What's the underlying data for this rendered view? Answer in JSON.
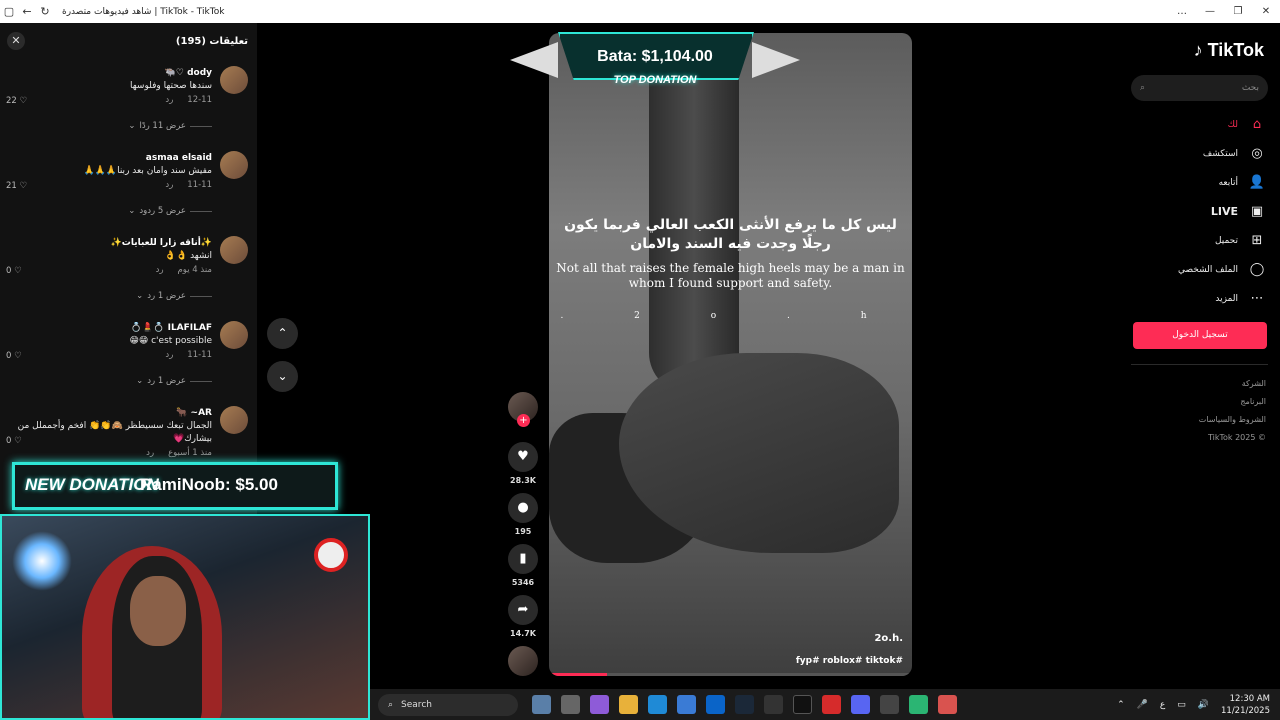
{
  "window": {
    "title": "شاهد فيديوهات متصدرة | TikTok - TikTok",
    "controls": [
      "…",
      "—",
      "❐",
      "✕"
    ]
  },
  "comments": {
    "title": "تعليقات (195)",
    "items": [
      {
        "user": "dody ♡🐃",
        "text": "سندها صحتها وفلوسها",
        "date": "12-11",
        "reply": "رد",
        "likes": "22",
        "replies": "عرض 11 ردًا"
      },
      {
        "user": "asmaa elsaid",
        "text": "مفيش سند وامان بعد ربنا🙏🙏🙏",
        "date": "11-11",
        "reply": "رد",
        "likes": "21",
        "replies": "عرض 5 ردود"
      },
      {
        "user": "✨أناقه زارا للعبايات✨",
        "text": "انشهد 👌👌",
        "date": "منذ 4 يوم",
        "reply": "رد",
        "likes": "0",
        "replies": "عرض 1 رد"
      },
      {
        "user": "ILAFILAF 💍💄💍",
        "text": "c'est possible 😁😁",
        "date": "11-11",
        "reply": "رد",
        "likes": "0",
        "replies": "عرض 1 رد"
      },
      {
        "user": "AR~ 🐂",
        "text": "الجمال تبعك سسيطظر 🙈👏👏 افخم وأجمملل من بيشارك💗",
        "date": "منذ 1 أسبوع",
        "reply": "رد",
        "likes": "0",
        "replies": ""
      }
    ]
  },
  "donations": {
    "new_label": "NEW DONATION",
    "new_amount": "RamiNoob: $5.00",
    "top_name": "Bata: $1,104.00",
    "top_label": "TOP DONATION"
  },
  "video": {
    "caption_ar": "ليس كل ما يرفع الأنثى الكعب العالي فربما يكون رجلًا وجدت فيه السند والامان",
    "caption_en": "Not all that raises the female high heels may be a man in whom I found support and safety.",
    "watermark": ". 2 o . h",
    "author": "2o.h.",
    "tags": "fyp# roblox# tiktok#",
    "progress": 0.16
  },
  "actions": {
    "likes": "28.3K",
    "comments": "195",
    "saves": "5346",
    "shares": "14.7K"
  },
  "sidebar": {
    "logo": "TikTok",
    "search_placeholder": "بحث",
    "menu": [
      {
        "label": "لك",
        "icon": "⌂"
      },
      {
        "label": "استكشف",
        "icon": "◎"
      },
      {
        "label": "أتابعه",
        "icon": "👤"
      },
      {
        "label": "LIVE",
        "icon": "▣"
      },
      {
        "label": "تحميل",
        "icon": "⊞"
      },
      {
        "label": "الملف الشخصي",
        "icon": "◯"
      },
      {
        "label": "المزيد",
        "icon": "⋯"
      }
    ],
    "login": "تسجيل الدخول",
    "footer": [
      "الشركة",
      "البرنامج",
      "الشروط والسياسات",
      "© 2025 TikTok"
    ]
  },
  "taskbar": {
    "search": "Search",
    "time": "12:30 AM",
    "date": "11/21/2025",
    "lang": "ع"
  },
  "colors": {
    "accent": "#fe2c55",
    "overlay": "#2ee6d6"
  }
}
